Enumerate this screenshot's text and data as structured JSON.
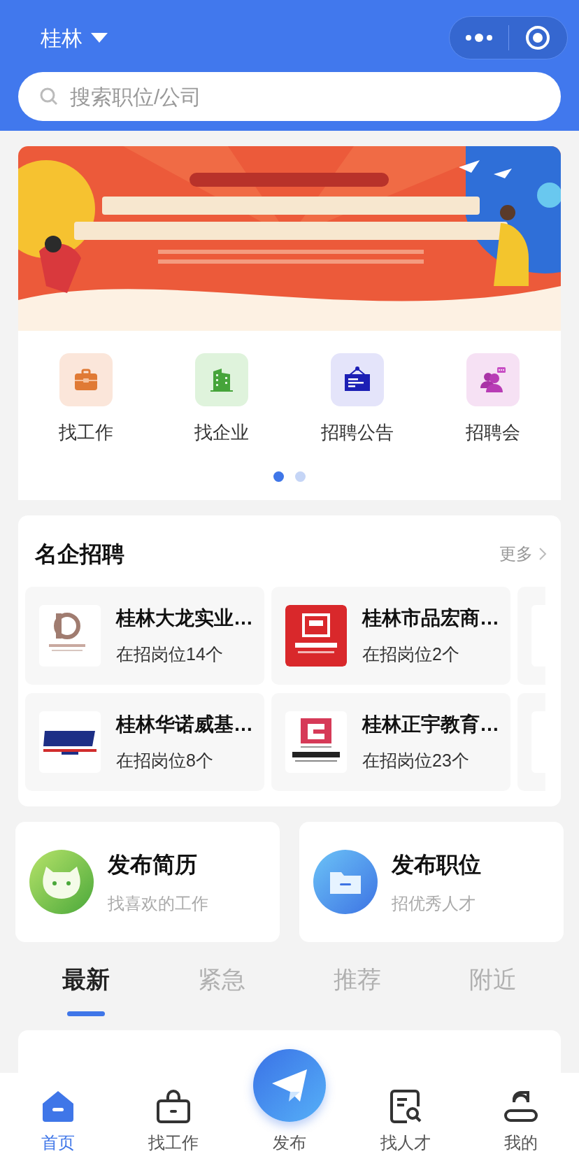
{
  "header": {
    "city": "桂林",
    "search": {
      "placeholder": "搜索职位/公司"
    }
  },
  "shortcuts": [
    {
      "label": "找工作"
    },
    {
      "label": "找企业"
    },
    {
      "label": "招聘公告"
    },
    {
      "label": "招聘会"
    }
  ],
  "pager": [
    {
      "selected": true
    },
    {
      "selected": false
    }
  ],
  "featured": {
    "title": "名企招聘",
    "more": "更多",
    "companies": [
      {
        "name": "桂林大龙实业…",
        "openings": "在招岗位14个"
      },
      {
        "name": "桂林市品宏商…",
        "openings": "在招岗位2个"
      },
      {
        "name": "桂林华诺威基…",
        "openings": "在招岗位8个"
      },
      {
        "name": "桂林正宇教育…",
        "openings": "在招岗位23个"
      }
    ]
  },
  "post": [
    {
      "title": "发布简历",
      "subtitle": "找喜欢的工作"
    },
    {
      "title": "发布职位",
      "subtitle": "招优秀人才"
    }
  ],
  "feed_tabs": [
    {
      "label": "最新",
      "selected": true
    },
    {
      "label": "紧急",
      "selected": false
    },
    {
      "label": "推荐",
      "selected": false
    },
    {
      "label": "附近",
      "selected": false
    }
  ],
  "nav": [
    {
      "label": "首页",
      "kind": "tab",
      "selected": true
    },
    {
      "label": "找工作",
      "kind": "tab",
      "selected": false
    },
    {
      "label": "发布",
      "kind": "publish",
      "selected": false
    },
    {
      "label": "找人才",
      "kind": "tab",
      "selected": false
    },
    {
      "label": "我的",
      "kind": "tab",
      "selected": false
    }
  ]
}
